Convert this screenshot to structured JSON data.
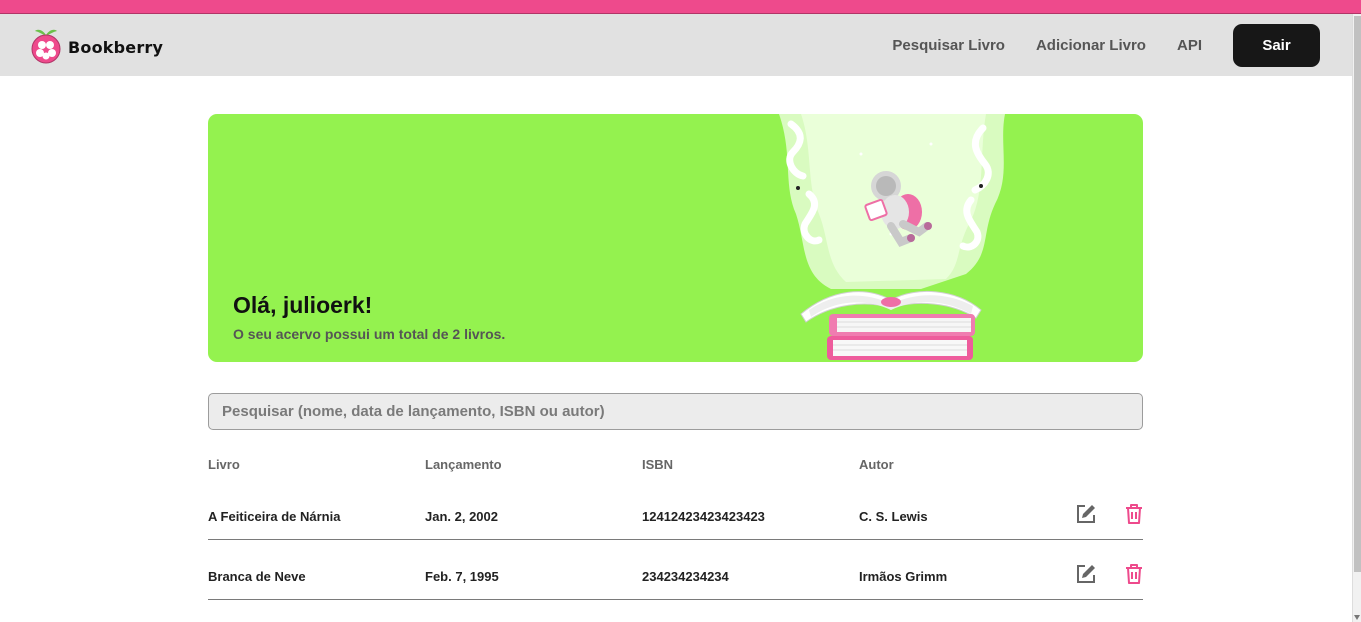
{
  "brand": {
    "name": "Bookberry",
    "logo_icon": "raspberry-logo-icon",
    "accent_color": "#ee4a8c"
  },
  "nav": {
    "links": [
      "Pesquisar Livro",
      "Adicionar Livro",
      "API"
    ],
    "logout_label": "Sair"
  },
  "hero": {
    "greeting": "Olá, julioerk!",
    "subtitle": "O seu acervo possui um total de 2 livros.",
    "background_color": "#94f24f",
    "illustration_icon": "astronaut-reading-books-illustration"
  },
  "search": {
    "placeholder": "Pesquisar (nome, data de lançamento, ISBN ou autor)",
    "value": ""
  },
  "table": {
    "headers": [
      "Livro",
      "Lançamento",
      "ISBN",
      "Autor"
    ],
    "rows": [
      {
        "title": "A Feiticeira de Nárnia",
        "release": "Jan. 2, 2002",
        "isbn": "12412423423423423",
        "author": "C. S. Lewis"
      },
      {
        "title": "Branca de Neve",
        "release": "Feb. 7, 1995",
        "isbn": "234234234234",
        "author": "Irmãos Grimm"
      }
    ],
    "edit_icon": "edit-icon",
    "delete_icon": "trash-icon",
    "delete_color": "#ee4a8c"
  }
}
